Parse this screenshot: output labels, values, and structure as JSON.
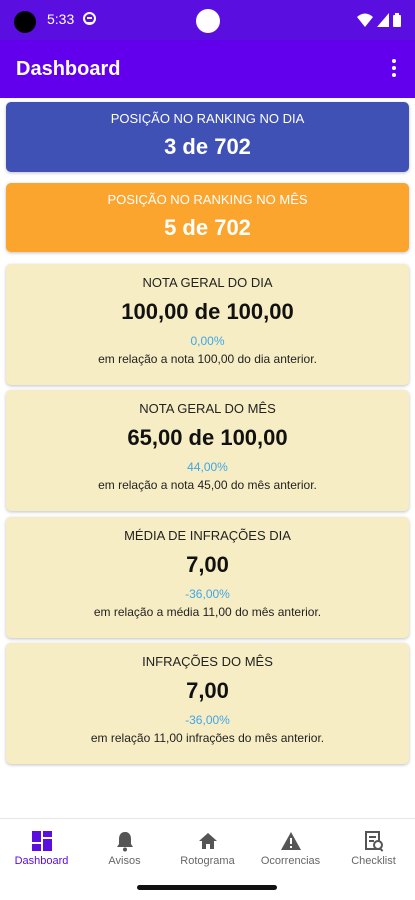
{
  "status_bar": {
    "time": "5:33"
  },
  "app_bar": {
    "title": "Dashboard"
  },
  "rank_day": {
    "label": "POSIÇÃO NO RANKING NO DIA",
    "value": "3 de 702"
  },
  "rank_month": {
    "label": "POSIÇÃO NO RANKING NO MÊS",
    "value": "5 de 702"
  },
  "stats": [
    {
      "label": "NOTA GERAL DO DIA",
      "value": "100,00 de 100,00",
      "pct": "0,00%",
      "sub": "em relação a nota 100,00 do dia anterior."
    },
    {
      "label": "NOTA GERAL DO MÊS",
      "value": "65,00 de 100,00",
      "pct": "44,00%",
      "sub": "em relação a nota 45,00 do mês anterior."
    },
    {
      "label": "MÉDIA DE INFRAÇÕES DIA",
      "value": "7,00",
      "pct": "-36,00%",
      "sub": "em relação a média 11,00 do mês anterior."
    },
    {
      "label": "INFRAÇÕES DO MÊS",
      "value": "7,00",
      "pct": "-36,00%",
      "sub": "em relação 11,00 infrações do mês anterior."
    }
  ],
  "bottom_nav": [
    {
      "label": "Dashboard",
      "icon": "dashboard-icon",
      "active": true
    },
    {
      "label": "Avisos",
      "icon": "bell-icon"
    },
    {
      "label": "Rotograma",
      "icon": "home-icon"
    },
    {
      "label": "Ocorrencias",
      "icon": "warning-icon"
    },
    {
      "label": "Checklist",
      "icon": "checklist-icon"
    }
  ],
  "colors": {
    "primary": "#6200ee",
    "status_bar": "#5a0ee0",
    "rank_day_bg": "#3f51b5",
    "rank_month_bg": "#fca52e",
    "stat_card_bg": "#f6edc4",
    "pct_text": "#3fa6e8"
  }
}
